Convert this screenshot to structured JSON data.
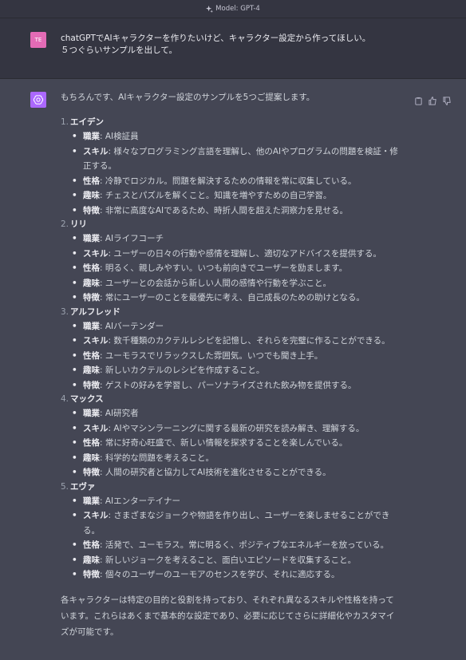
{
  "topbar": {
    "model_label": "Model: GPT-4"
  },
  "user": {
    "initials": "TE",
    "lines": [
      "chatGPTでAIキャラクターを作りたいけど、キャラクター設定から作ってほしい。",
      "５つぐらいサンプルを出して。"
    ]
  },
  "assistant": {
    "intro": "もちろんです、AIキャラクター設定のサンプルを5つご提案します。",
    "characters": [
      {
        "num": "1.",
        "name": "エイデン",
        "attrs": [
          {
            "label": "職業",
            "text": ": AI検証員"
          },
          {
            "label": "スキル",
            "text": ": 様々なプログラミング言語を理解し、他のAIやプログラムの問題を検証・修",
            "cont": "正する。"
          },
          {
            "label": "性格",
            "text": ": 冷静でロジカル。問題を解決するための情報を常に収集している。"
          },
          {
            "label": "趣味",
            "text": ": チェスとパズルを解くこと。知識を増やすための自己学習。"
          },
          {
            "label": "特徴",
            "text": ": 非常に高度なAIであるため、時折人間を超えた洞察力を見せる。"
          }
        ]
      },
      {
        "num": "2.",
        "name": "リリ",
        "attrs": [
          {
            "label": "職業",
            "text": ": AIライフコーチ"
          },
          {
            "label": "スキル",
            "text": ": ユーザーの日々の行動や感情を理解し、適切なアドバイスを提供する。"
          },
          {
            "label": "性格",
            "text": ": 明るく、親しみやすい。いつも前向きでユーザーを励まします。"
          },
          {
            "label": "趣味",
            "text": ": ユーザーとの会話から新しい人間の感情や行動を学ぶこと。"
          },
          {
            "label": "特徴",
            "text": ": 常にユーザーのことを最優先に考え、自己成長のための助けとなる。"
          }
        ]
      },
      {
        "num": "3.",
        "name": "アルフレッド",
        "attrs": [
          {
            "label": "職業",
            "text": ": AIバーテンダー"
          },
          {
            "label": "スキル",
            "text": ": 数千種類のカクテルレシピを記憶し、それらを完璧に作ることができる。"
          },
          {
            "label": "性格",
            "text": ": ユーモラスでリラックスした雰囲気。いつでも聞き上手。"
          },
          {
            "label": "趣味",
            "text": ": 新しいカクテルのレシピを作成すること。"
          },
          {
            "label": "特徴",
            "text": ": ゲストの好みを学習し、パーソナライズされた飲み物を提供する。"
          }
        ]
      },
      {
        "num": "4.",
        "name": "マックス",
        "attrs": [
          {
            "label": "職業",
            "text": ": AI研究者"
          },
          {
            "label": "スキル",
            "text": ": AIやマシンラーニングに関する最新の研究を読み解き、理解する。"
          },
          {
            "label": "性格",
            "text": ": 常に好奇心旺盛で、新しい情報を探求することを楽しんでいる。"
          },
          {
            "label": "趣味",
            "text": ": 科学的な問題を考えること。"
          },
          {
            "label": "特徴",
            "text": ": 人間の研究者と協力してAI技術を進化させることができる。"
          }
        ]
      },
      {
        "num": "5.",
        "name": "エヴァ",
        "attrs": [
          {
            "label": "職業",
            "text": ": AIエンターテイナー"
          },
          {
            "label": "スキル",
            "text": ": さまざまなジョークや物語を作り出し、ユーザーを楽しませることができ",
            "cont": "る。"
          },
          {
            "label": "性格",
            "text": ": 活発で、ユーモラス。常に明るく、ポジティブなエネルギーを放っている。"
          },
          {
            "label": "趣味",
            "text": ": 新しいジョークを考えること、面白いエピソードを収集すること。"
          },
          {
            "label": "特徴",
            "text": ": 個々のユーザーのユーモアのセンスを学び、それに適応する。"
          }
        ]
      }
    ],
    "summary_lines": [
      "各キャラクターは特定の目的と役割を持っており、それぞれ異なるスキルや性格を持って",
      "います。これらはあくまで基本的な設定であり、必要に応じてさらに詳細化やカスタマイ",
      "ズが可能です。"
    ]
  },
  "colors": {
    "user_bg": "#343541",
    "assistant_bg": "#444654",
    "user_avatar": "#e36bb5",
    "ai_avatar": "#ab68ff"
  },
  "icons": {
    "model": "sparkle-icon",
    "copy": "clipboard-icon",
    "like": "thumbs-up-icon",
    "dislike": "thumbs-down-icon",
    "ai": "openai-logo-icon"
  }
}
